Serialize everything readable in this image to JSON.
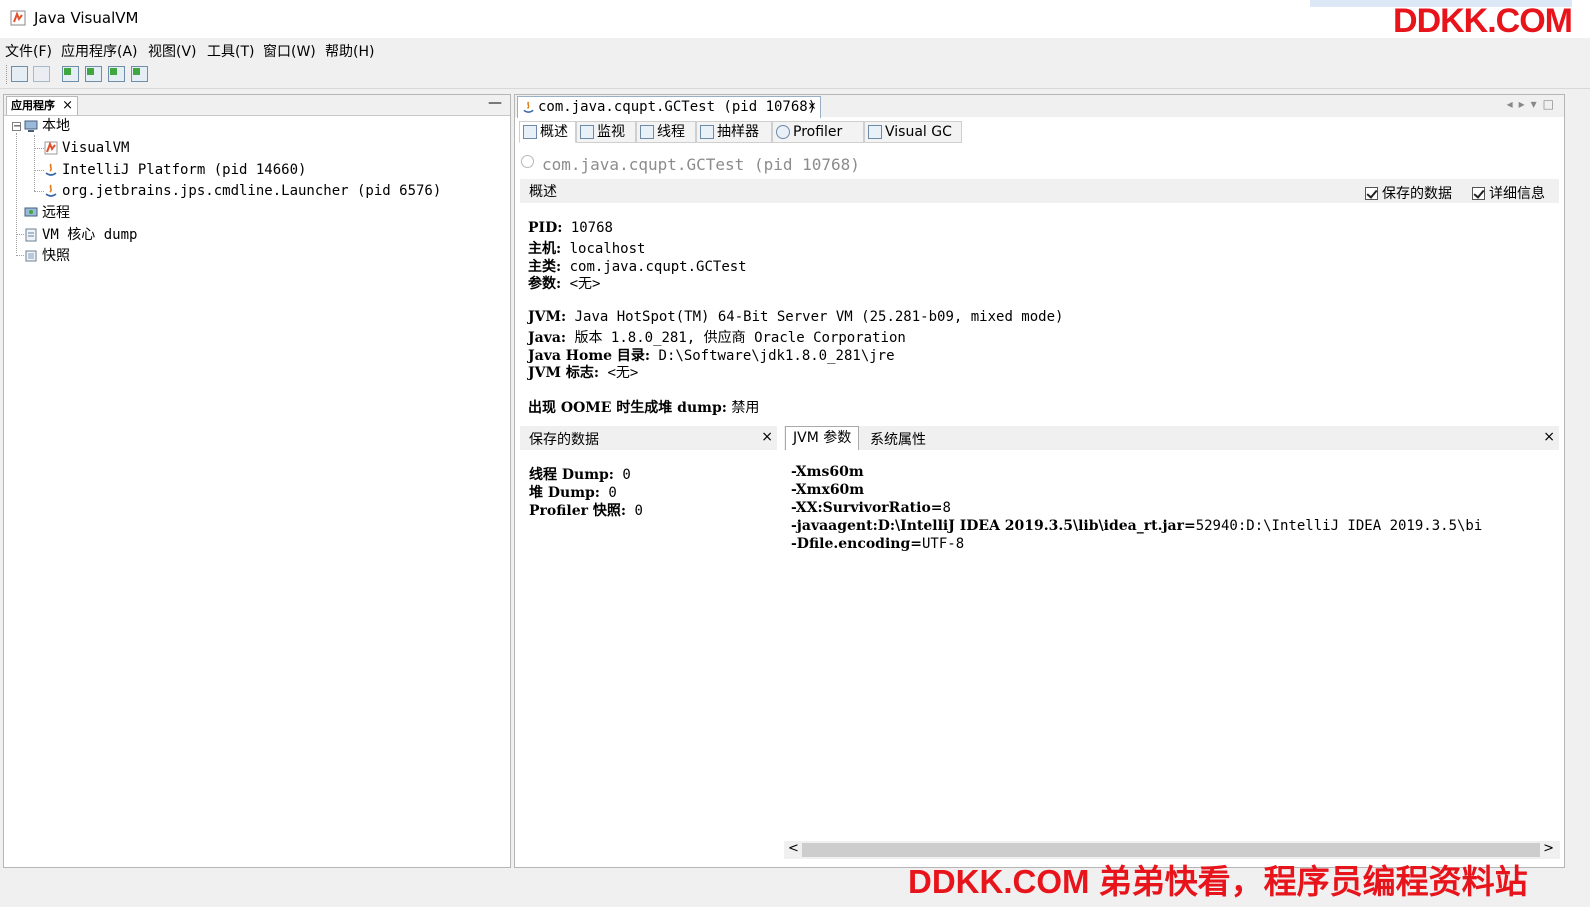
{
  "window": {
    "title": "Java VisualVM"
  },
  "watermark": {
    "top": "DDKK.COM",
    "bottom": "DDKK.COM 弟弟快看，程序员编程资料站"
  },
  "menu": [
    "文件(F)",
    "应用程序(A)",
    "视图(V)",
    "工具(T)",
    "窗口(W)",
    "帮助(H)"
  ],
  "toolbar": {
    "icons": [
      "load-icon",
      "save-icon",
      "add-jmx-connection-icon",
      "add-remote-host-icon",
      "add-vm-coredump-icon",
      "add-snapshot-icon"
    ]
  },
  "left": {
    "tab_label": "应用程序",
    "tree": {
      "local": "本地",
      "local_children": [
        "VisualVM",
        "IntelliJ Platform (pid 14660)",
        "org.jetbrains.jps.cmdline.Launcher (pid 6576)"
      ],
      "remote": "远程",
      "coredump": "VM 核心 dump",
      "snapshots": "快照"
    }
  },
  "doc_tab": {
    "label": "com.java.cqupt.GCTest (pid 10768)"
  },
  "view_tabs": [
    "概述",
    "监视",
    "线程",
    "抽样器",
    "Profiler",
    "Visual GC"
  ],
  "overview": {
    "process_title": "com.java.cqupt.GCTest",
    "process_pid": "(pid 10768)",
    "section_label": "概述",
    "checkbox_saved": "保存的数据",
    "checkbox_details": "详细信息",
    "info": [
      {
        "label": "PID:",
        "value": " 10768"
      },
      {
        "label": "主机:",
        "value": " localhost"
      },
      {
        "label": "主类:",
        "value": " com.java.cqupt.GCTest"
      },
      {
        "label": "参数:",
        "value": " <无>"
      },
      {
        "label": "JVM:",
        "value": " Java HotSpot(TM) 64-Bit Server VM (25.281-b09, mixed mode)"
      },
      {
        "label": "Java:",
        "value": " 版本 1.8.0_281, 供应商 Oracle Corporation"
      },
      {
        "label": "Java Home 目录:",
        "value": " D:\\Software\\jdk1.8.0_281\\jre"
      },
      {
        "label": "JVM 标志:",
        "value": " <无>"
      },
      {
        "label": "出现 OOME 时生成堆 dump:",
        "value": " 禁用"
      }
    ]
  },
  "saved_data": {
    "title": "保存的数据",
    "rows": [
      {
        "label": "线程 Dump:",
        "value": " 0"
      },
      {
        "label": "堆 Dump:",
        "value": " 0"
      },
      {
        "label": "Profiler 快照:",
        "value": " 0"
      }
    ]
  },
  "jvm_panel": {
    "tab_jvm": "JVM 参数",
    "tab_sys": "系统属性",
    "args": [
      {
        "key": "-Xms60m",
        "value": ""
      },
      {
        "key": "-Xmx60m",
        "value": ""
      },
      {
        "key": "-XX:SurvivorRatio=",
        "value": "8"
      },
      {
        "key": "-javaagent:D:\\IntelliJ  IDEA  2019.3.5\\lib\\idea_rt.jar=",
        "value": "52940:D:\\IntelliJ  IDEA  2019.3.5\\bi"
      },
      {
        "key": "-Dfile.encoding=",
        "value": "UTF-8"
      }
    ]
  }
}
